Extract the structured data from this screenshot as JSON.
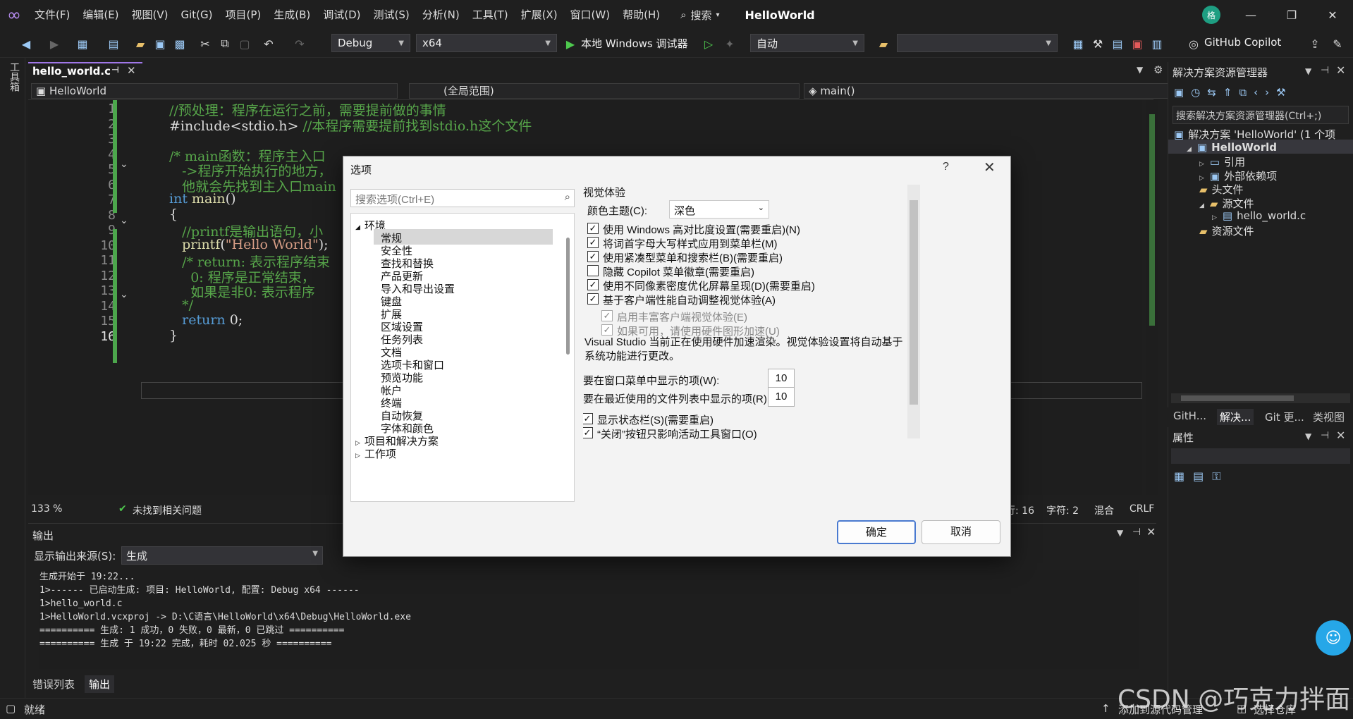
{
  "menu": [
    "文件(F)",
    "编辑(E)",
    "视图(V)",
    "Git(G)",
    "项目(P)",
    "生成(B)",
    "调试(D)",
    "测试(S)",
    "分析(N)",
    "工具(T)",
    "扩展(X)",
    "窗口(W)",
    "帮助(H)"
  ],
  "search_label": "搜索",
  "app_title": "HelloWorld",
  "avatar_text": "格",
  "toolbar": {
    "config": "Debug",
    "platform": "x64",
    "run_label": "本地 Windows 调试器",
    "auto": "自动",
    "copilot": "GitHub Copilot"
  },
  "left_tab": "工具箱",
  "editor": {
    "tab_name": "hello_world.c",
    "nav_project": "HelloWorld",
    "nav_scope": "(全局范围)",
    "nav_func": "main()",
    "lines": [
      {
        "n": "1",
        "parts": [
          {
            "t": "//预处理：程序在运行之前，需要提前做的事情",
            "c": "cmt"
          }
        ]
      },
      {
        "n": "2",
        "parts": [
          {
            "t": "#include<stdio.h> ",
            "c": "pl"
          },
          {
            "t": "//本程序需要提前找到stdio.h这个文件",
            "c": "cmt"
          }
        ]
      },
      {
        "n": "3",
        "parts": []
      },
      {
        "n": "4",
        "parts": [
          {
            "t": "/* main函数：程序主入口",
            "c": "cmt"
          }
        ]
      },
      {
        "n": "5",
        "parts": [
          {
            "t": "   ->程序开始执行的地方，",
            "c": "cmt"
          }
        ]
      },
      {
        "n": "6",
        "parts": [
          {
            "t": "   他就会先找到主入口main",
            "c": "cmt"
          }
        ]
      },
      {
        "n": "7",
        "parts": [
          {
            "t": "int ",
            "c": "kw"
          },
          {
            "t": "main",
            "c": "fn"
          },
          {
            "t": "()",
            "c": "pl"
          }
        ]
      },
      {
        "n": "8",
        "parts": [
          {
            "t": "{",
            "c": "pl"
          }
        ]
      },
      {
        "n": "9",
        "parts": [
          {
            "t": "   //printf是输出语句，小",
            "c": "cmt"
          }
        ]
      },
      {
        "n": "10",
        "parts": [
          {
            "t": "   ",
            "c": "pl"
          },
          {
            "t": "printf",
            "c": "fn"
          },
          {
            "t": "(",
            "c": "pl"
          },
          {
            "t": "\"Hello World\"",
            "c": "str"
          },
          {
            "t": ");",
            "c": "pl"
          }
        ]
      },
      {
        "n": "11",
        "parts": [
          {
            "t": "   /* return: 表示程序结束",
            "c": "cmt"
          }
        ]
      },
      {
        "n": "12",
        "parts": [
          {
            "t": "     0: 程序是正常结束，",
            "c": "cmt"
          }
        ]
      },
      {
        "n": "13",
        "parts": [
          {
            "t": "     如果是非0: 表示程序",
            "c": "cmt"
          }
        ]
      },
      {
        "n": "14",
        "parts": [
          {
            "t": "   */",
            "c": "cmt"
          }
        ]
      },
      {
        "n": "15",
        "parts": [
          {
            "t": "   ",
            "c": "pl"
          },
          {
            "t": "return ",
            "c": "kw"
          },
          {
            "t": "0;",
            "c": "pl"
          }
        ]
      },
      {
        "n": "16",
        "parts": [
          {
            "t": "}",
            "c": "pl"
          }
        ]
      }
    ],
    "zoom": "133 %",
    "issues": "未找到相关问题",
    "line_info": "行: 16",
    "char_info": "字符: 2",
    "mixed": "混合",
    "crlf": "CRLF"
  },
  "output": {
    "title": "输出",
    "source_label": "显示输出来源(S):",
    "source_value": "生成",
    "text": "生成开始于 19:22...\n1>------ 已启动生成: 项目: HelloWorld, 配置: Debug x64 ------\n1>hello_world.c\n1>HelloWorld.vcxproj -> D:\\C语言\\HelloWorld\\x64\\Debug\\HelloWorld.exe\n========== 生成: 1 成功，0 失败，0 最新，0 已跳过 ==========\n========== 生成 于 19:22 完成，耗时 02.025 秒 =========="
  },
  "bottom_tabs": [
    "错误列表",
    "输出"
  ],
  "solution": {
    "title": "解决方案资源管理器",
    "search": "搜索解决方案资源管理器(Ctrl+;)",
    "items": [
      {
        "label": "解决方案 'HelloWorld' (1 个项",
        "level": 0,
        "bold": false
      },
      {
        "label": "HelloWorld",
        "level": 1,
        "bold": true
      },
      {
        "label": "引用",
        "level": 2,
        "bold": false
      },
      {
        "label": "外部依赖项",
        "level": 2,
        "bold": false
      },
      {
        "label": "头文件",
        "level": 2,
        "bold": false
      },
      {
        "label": "源文件",
        "level": 2,
        "bold": false
      },
      {
        "label": "hello_world.c",
        "level": 3,
        "bold": false
      },
      {
        "label": "资源文件",
        "level": 2,
        "bold": false
      }
    ]
  },
  "right_tabs": [
    "GitH...",
    "解决...",
    "Git 更...",
    "类视图"
  ],
  "properties_title": "属性",
  "statusbar": {
    "ready": "就绪",
    "add_source": "添加到源代码管理",
    "select_repo": "选择仓库"
  },
  "watermark": "CSDN @巧克力拌面",
  "dialog": {
    "title": "选项",
    "help": "?",
    "search_placeholder": "搜索选项(Ctrl+E)",
    "tree": [
      {
        "label": "环境",
        "level": 0,
        "expanded": true
      },
      {
        "label": "常规",
        "level": 1,
        "selected": true
      },
      {
        "label": "安全性",
        "level": 1
      },
      {
        "label": "查找和替换",
        "level": 1
      },
      {
        "label": "产品更新",
        "level": 1
      },
      {
        "label": "导入和导出设置",
        "level": 1
      },
      {
        "label": "键盘",
        "level": 1
      },
      {
        "label": "扩展",
        "level": 1
      },
      {
        "label": "区域设置",
        "level": 1
      },
      {
        "label": "任务列表",
        "level": 1
      },
      {
        "label": "文档",
        "level": 1
      },
      {
        "label": "选项卡和窗口",
        "level": 1
      },
      {
        "label": "预览功能",
        "level": 1
      },
      {
        "label": "帐户",
        "level": 1
      },
      {
        "label": "终端",
        "level": 1
      },
      {
        "label": "自动恢复",
        "level": 1
      },
      {
        "label": "字体和颜色",
        "level": 1
      },
      {
        "label": "项目和解决方案",
        "level": 0,
        "expanded": false
      },
      {
        "label": "工作项",
        "level": 0,
        "expanded": false
      }
    ],
    "section": "视觉体验",
    "theme_label": "颜色主题(C):",
    "theme_value": "深色",
    "checks": [
      {
        "label": "使用 Windows 高对比度设置(需要重启)(N)",
        "checked": true,
        "disabled": false
      },
      {
        "label": "将词首字母大写样式应用到菜单栏(M)",
        "checked": true,
        "disabled": false
      },
      {
        "label": "使用紧凑型菜单和搜索栏(B)(需要重启)",
        "checked": true,
        "disabled": false
      },
      {
        "label": "隐藏 Copilot 菜单徽章(需要重启)",
        "checked": false,
        "disabled": false
      },
      {
        "label": "使用不同像素密度优化屏幕呈现(D)(需要重启)",
        "checked": true,
        "disabled": false
      },
      {
        "label": "基于客户端性能自动调整视觉体验(A)",
        "checked": true,
        "disabled": false
      },
      {
        "label": "启用丰富客户端视觉体验(E)",
        "checked": true,
        "disabled": true
      },
      {
        "label": "如果可用，请使用硬件图形加速(U)",
        "checked": true,
        "disabled": true
      }
    ],
    "info": "Visual Studio 当前正在使用硬件加速渲染。视觉体验设置将自动基于系统功能进行更改。",
    "window_menu_label": "要在窗口菜单中显示的项(W):",
    "window_menu_value": "10",
    "recent_label": "要在最近使用的文件列表中显示的项(R):",
    "recent_value": "10",
    "checks2": [
      {
        "label": "显示状态栏(S)(需要重启)",
        "checked": true
      },
      {
        "label": "“关闭”按钮只影响活动工具窗口(O)",
        "checked": true
      }
    ],
    "ok": "确定",
    "cancel": "取消"
  }
}
